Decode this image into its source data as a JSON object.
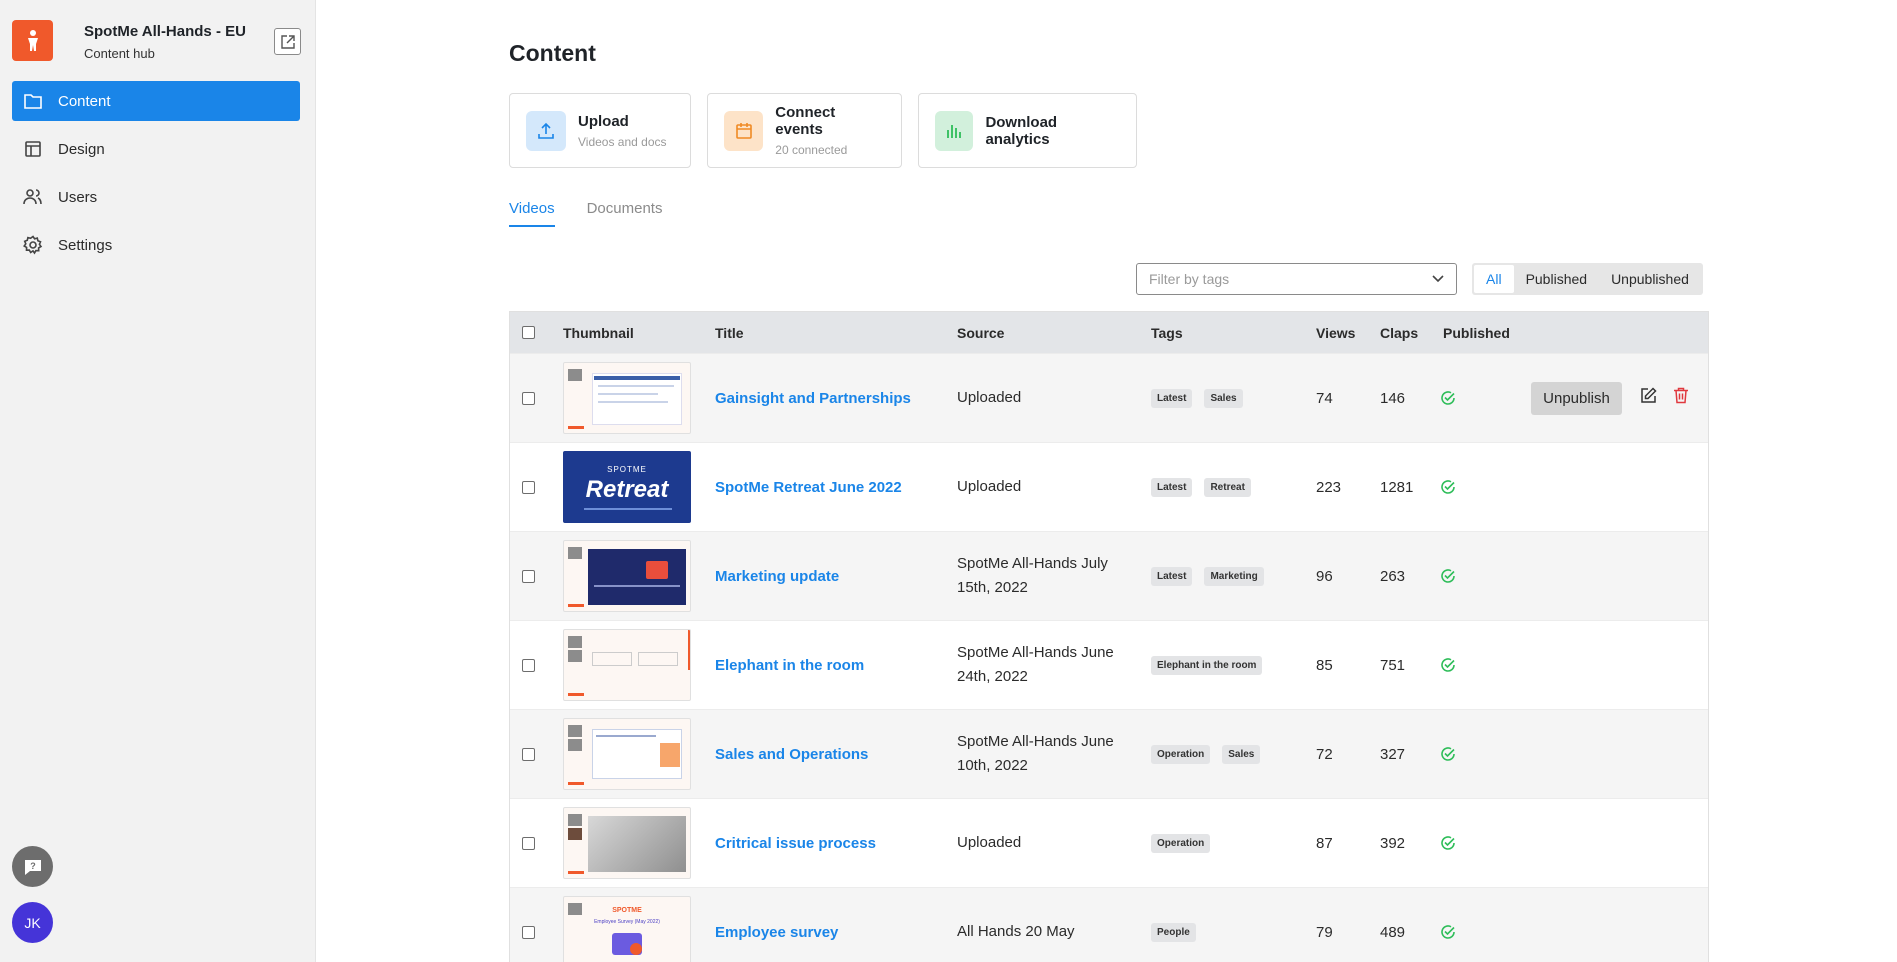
{
  "app": {
    "title": "SpotMe All-Hands - EU",
    "subtitle": "Content hub",
    "avatar_initials": "JK"
  },
  "sidebar": {
    "items": [
      {
        "label": "Content",
        "icon": "folder-icon",
        "active": true
      },
      {
        "label": "Design",
        "icon": "layout-icon",
        "active": false
      },
      {
        "label": "Users",
        "icon": "users-icon",
        "active": false
      },
      {
        "label": "Settings",
        "icon": "gear-icon",
        "active": false
      }
    ]
  },
  "page": {
    "title": "Content"
  },
  "cards": [
    {
      "title": "Upload",
      "subtitle": "Videos and docs",
      "icon": "upload-icon"
    },
    {
      "title": "Connect events",
      "subtitle": "20 connected",
      "icon": "calendar-icon"
    },
    {
      "title": "Download analytics",
      "subtitle": "",
      "icon": "bar-chart-icon"
    }
  ],
  "tabs": [
    {
      "label": "Videos",
      "active": true
    },
    {
      "label": "Documents",
      "active": false
    }
  ],
  "filter": {
    "placeholder": "Filter by tags"
  },
  "status_filter": {
    "options": [
      "All",
      "Published",
      "Unpublished"
    ],
    "selected": "All"
  },
  "table": {
    "columns": [
      "Thumbnail",
      "Title",
      "Source",
      "Tags",
      "Views",
      "Claps",
      "Published"
    ],
    "rows": [
      {
        "title": "Gainsight and Partnerships",
        "source": "Uploaded",
        "tags": [
          "Latest",
          "Sales"
        ],
        "views": "74",
        "claps": "146",
        "published": true
      },
      {
        "title": "SpotMe Retreat June 2022",
        "source": "Uploaded",
        "tags": [
          "Latest",
          "Retreat"
        ],
        "views": "223",
        "claps": "1281",
        "published": true
      },
      {
        "title": "Marketing update",
        "source": "SpotMe All-Hands July 15th, 2022",
        "tags": [
          "Latest",
          "Marketing"
        ],
        "views": "96",
        "claps": "263",
        "published": true
      },
      {
        "title": "Elephant in the room",
        "source": "SpotMe All-Hands June 24th, 2022",
        "tags": [
          "Elephant in the room"
        ],
        "views": "85",
        "claps": "751",
        "published": true
      },
      {
        "title": "Sales and Operations",
        "source": "SpotMe All-Hands June 10th, 2022",
        "tags": [
          "Operation",
          "Sales"
        ],
        "views": "72",
        "claps": "327",
        "published": true
      },
      {
        "title": "Critrical issue process",
        "source": "Uploaded",
        "tags": [
          "Operation"
        ],
        "views": "87",
        "claps": "392",
        "published": true
      },
      {
        "title": "Employee survey",
        "source": "All Hands 20 May",
        "tags": [
          "People"
        ],
        "views": "79",
        "claps": "489",
        "published": true
      }
    ],
    "row_actions": {
      "unpublish_label": "Unpublish"
    },
    "retreat_thumb": {
      "kicker": "SPOTME",
      "word": "Retreat"
    },
    "survey_thumb": {
      "kicker": "SPOTME",
      "caption": "Employee Survey (May 2022)"
    }
  },
  "colors": {
    "accent": "#1a85e8",
    "brand": "#f0592b",
    "published": "#2ebd59",
    "danger": "#e0383e"
  }
}
